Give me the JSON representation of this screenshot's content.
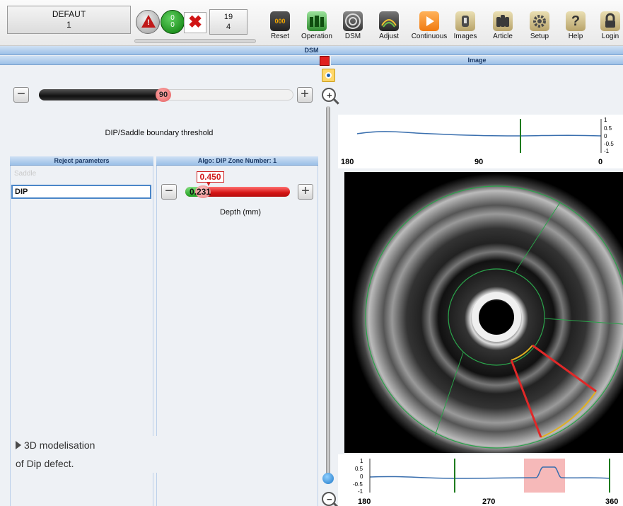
{
  "toolbar": {
    "status_title": "DEFAUT",
    "status_value": "1",
    "warning_mark": "!",
    "counter_top": "0",
    "counter_bottom": "0",
    "reject_mark": "✖",
    "count_top": "19",
    "count_bottom": "4",
    "reset_counter": "000",
    "tools": [
      {
        "label": "Reset",
        "icon": "reset-icon"
      },
      {
        "label": "Operation",
        "icon": "operation-icon"
      },
      {
        "label": "DSM",
        "icon": "dsm-icon"
      },
      {
        "label": "Adjust",
        "icon": "adjust-icon"
      },
      {
        "label": "Continuous",
        "icon": "continuous-icon"
      },
      {
        "label": "Images",
        "icon": "images-icon"
      },
      {
        "label": "Article",
        "icon": "article-icon"
      },
      {
        "label": "Setup",
        "icon": "setup-icon"
      },
      {
        "label": "Help",
        "icon": "help-icon"
      },
      {
        "label": "Login",
        "icon": "login-icon"
      }
    ]
  },
  "dsm_title": "DSM",
  "image_title": "Image",
  "threshold": {
    "value": "90",
    "fraction": 0.5,
    "label": "DIP/Saddle boundary threshold",
    "minus": "−",
    "plus": "+"
  },
  "reject_params": {
    "title": "Reject parameters",
    "items": [
      "Saddle",
      "DIP"
    ]
  },
  "algo": {
    "title": "Algo: DIP Zone Number: 1",
    "target": "0.450",
    "value": "0.231",
    "label": "Depth (mm)",
    "minus": "−",
    "plus": "+"
  },
  "top_plot": {
    "x_labels": [
      "180",
      "90",
      "0"
    ],
    "y_labels": [
      "1",
      "0.5",
      "0",
      "-0.5",
      "-1"
    ]
  },
  "bottom_plot": {
    "x_labels": [
      "180",
      "270",
      "360"
    ],
    "y_labels": [
      "1",
      "0.5",
      "0",
      "-0.5",
      "-1"
    ]
  },
  "caption": {
    "line1": "3D modelisation",
    "line2": "of Dip defect."
  },
  "colors": {
    "header_blue": "#9cc0e8",
    "reject_red": "#d01515",
    "ok_green": "#1e9e1e",
    "defect_highlight": "#f6b9b9"
  }
}
